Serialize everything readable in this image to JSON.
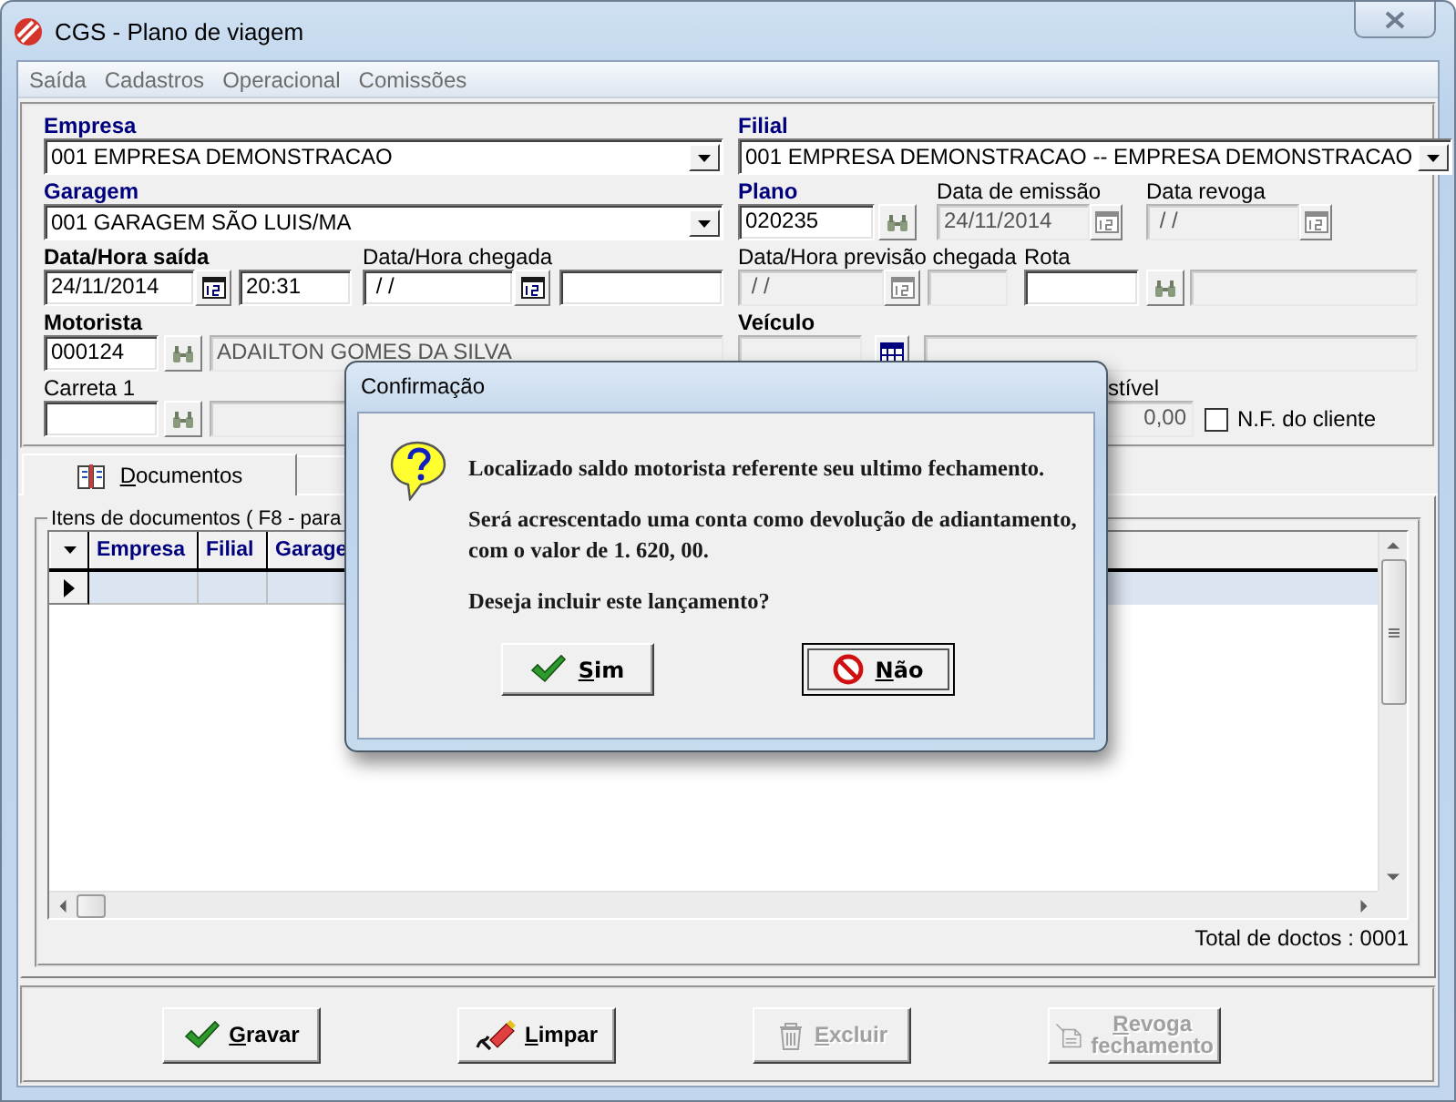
{
  "window": {
    "title": "CGS - Plano de viagem"
  },
  "menu": [
    {
      "label": "Saída"
    },
    {
      "label": "Cadastros"
    },
    {
      "label": "Operacional"
    },
    {
      "label": "Comissões"
    }
  ],
  "form": {
    "empresa": {
      "label": "Empresa",
      "kind": "primary",
      "value": "001 EMPRESA DEMONSTRACAO"
    },
    "garagem": {
      "label": "Garagem",
      "kind": "primary",
      "value": "001 GARAGEM SÃO LUIS/MA"
    },
    "saida": {
      "label": "Data/Hora saída",
      "kind": "strong",
      "date": {
        "value": "24/11/2014",
        "disabled": false
      },
      "time": {
        "value": "20:31",
        "disabled": false
      }
    },
    "chegada": {
      "label": "Data/Hora chegada",
      "kind": "normal",
      "date": {
        "value": " / /",
        "disabled": false
      },
      "time": {
        "disabled": false
      }
    },
    "motorista": {
      "label": "Motorista",
      "kind": "strong",
      "code": {
        "value": "000124",
        "disabled": false
      },
      "name": {
        "value": "ADAILTON GOMES DA SILVA",
        "disabled": true
      }
    },
    "carreta": {
      "label": "Carreta 1",
      "kind": "normal",
      "code": {
        "disabled": false
      },
      "name": {
        "disabled": true
      }
    },
    "filial": {
      "label": "Filial",
      "kind": "primary",
      "value": "001 EMPRESA DEMONSTRACAO -- EMPRESA DEMONSTRACAO"
    },
    "plano": {
      "label": "Plano",
      "kind": "primary",
      "code": {
        "value": "020235",
        "disabled": false
      }
    },
    "emissao": {
      "label": "Data de emissão",
      "kind": "normal",
      "date": {
        "value": "24/11/2014",
        "disabled": true
      }
    },
    "revoga": {
      "label": "Data revoga",
      "kind": "normal",
      "date": {
        "value": " / /",
        "disabled": true
      }
    },
    "previsao": {
      "label": "Data/Hora previsão chegada",
      "kind": "normal",
      "date": {
        "value": " / /",
        "disabled": true
      },
      "time": {
        "disabled": true
      }
    },
    "rota": {
      "label": "Rota",
      "kind": "normal",
      "code": {
        "disabled": false
      },
      "name": {
        "disabled": true
      }
    },
    "veiculo": {
      "label": "Veículo",
      "kind": "strong",
      "code": {
        "disabled": true
      },
      "name": {
        "disabled": true
      }
    },
    "combustivel": {
      "label": "stível",
      "kind": "normal",
      "field": {
        "value": "0,00",
        "disabled": true
      }
    },
    "nf_cliente": {
      "label": "N.F. do cliente",
      "checked": false
    }
  },
  "tabs": [
    {
      "label": "Documentos",
      "selected": true
    }
  ],
  "documents": {
    "title": "Itens de documentos ( F8 - para",
    "columns": [
      "Empresa",
      "Filial",
      "Garage"
    ],
    "rows": [
      {
        "selected": true
      }
    ],
    "total": "Total de doctos : 0001"
  },
  "buttons": [
    {
      "label": "Gravar",
      "kind": "save",
      "disabled": false
    },
    {
      "label": "Limpar",
      "kind": "clear",
      "disabled": false
    },
    {
      "label": "Excluir",
      "kind": "delete",
      "disabled": true
    },
    {
      "label": "Revoga fechamento",
      "kind": "revoke",
      "disabled": true
    }
  ],
  "dialog": {
    "title": "Confirmação",
    "paragraphs": [
      [
        "Localizado saldo motorista referente seu ultimo fechamento."
      ],
      [
        "Será acrescentado uma conta como devolução de adiantamento,",
        "com o valor de 1. 620, 00."
      ],
      [
        "Deseja incluir este lançamento?"
      ]
    ],
    "buttons": [
      {
        "label": "Sim",
        "kind": "yes",
        "focused": false
      },
      {
        "label": "Não",
        "kind": "no",
        "focused": true
      }
    ]
  }
}
